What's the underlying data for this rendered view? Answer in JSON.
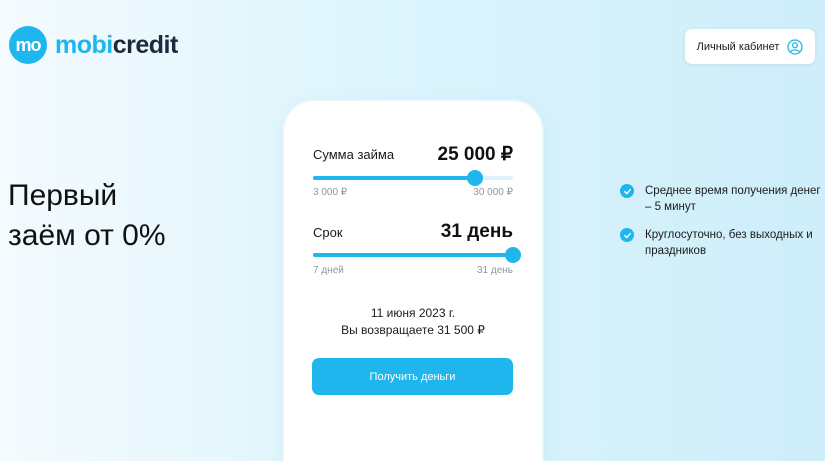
{
  "brand": {
    "mark": "mo",
    "name_prefix": "mobi",
    "name_suffix": "credit"
  },
  "header": {
    "account_label": "Личный кабинет",
    "account_icon": "user-circle-icon"
  },
  "hero": {
    "line1": "Первый",
    "line2": "заём от 0%"
  },
  "calculator": {
    "amount": {
      "label": "Сумма займа",
      "value": "25 000 ₽",
      "min": "3 000 ₽",
      "max": "30 000 ₽",
      "fraction": 0.81
    },
    "term": {
      "label": "Срок",
      "value": "31 день",
      "min": "7 дней",
      "max": "31 день",
      "fraction": 1.0
    },
    "summary_date": "11 июня 2023 г.",
    "summary_return": "Вы возвращаете 31 500 ₽",
    "submit_label": "Получить деньги"
  },
  "features": [
    {
      "text": "Среднее время получения денег – 5 минут",
      "icon": "check-icon"
    },
    {
      "text": "Круглосуточно, без выходных и праздников",
      "icon": "check-icon"
    }
  ],
  "colors": {
    "accent": "#1fb6ee",
    "track": "#dcf3fb",
    "dark": "#1c2b3a"
  }
}
